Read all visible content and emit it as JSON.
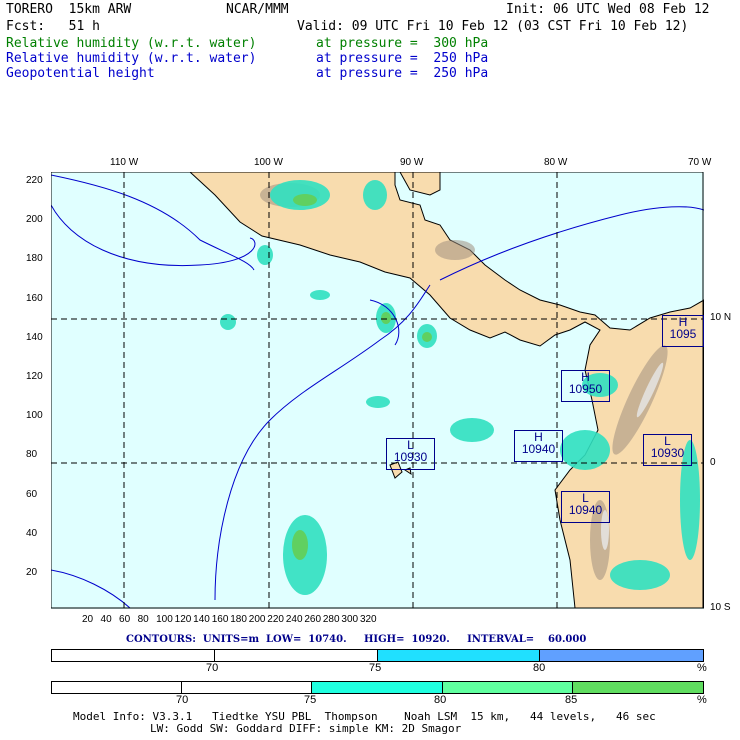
{
  "header": {
    "model": "TORERO  15km ARW",
    "org": "NCAR/MMM",
    "init": "Init: 06 UTC Wed 08 Feb 12",
    "fcst": "Fcst:   51 h",
    "valid": "Valid: 09 UTC Fri 10 Feb 12 (03 CST Fri 10 Feb 12)",
    "fields": [
      {
        "name": "Relative humidity (w.r.t. water)",
        "level": "at pressure =  300 hPa",
        "color": "#008000"
      },
      {
        "name": "Relative humidity (w.r.t. water)",
        "level": "at pressure =  250 hPa",
        "color": "#0000cc"
      },
      {
        "name": "Geopotential height",
        "level": "at pressure =  250 hPa",
        "color": "#0000cc"
      }
    ]
  },
  "map": {
    "lon_labels": [
      "110 W",
      "100 W",
      "90 W",
      "80 W",
      "70 W"
    ],
    "lat_labels": [
      "10 N",
      "0",
      "10 S"
    ],
    "y_ticks": [
      "220",
      "200",
      "180",
      "160",
      "140",
      "120",
      "100",
      "80",
      "60",
      "40",
      "20"
    ],
    "x_ticks": [
      "20",
      "40",
      "60",
      "80",
      "100",
      "120",
      "140",
      "160",
      "180",
      "200",
      "220",
      "240",
      "260",
      "280",
      "300",
      "320"
    ],
    "centers": [
      {
        "type": "L",
        "value": "10930"
      },
      {
        "type": "H",
        "value": "10940"
      },
      {
        "type": "H",
        "value": "10950"
      },
      {
        "type": "H",
        "value": "1095"
      },
      {
        "type": "L",
        "value": "10930"
      },
      {
        "type": "L",
        "value": "10940"
      }
    ]
  },
  "contours": "CONTOURS:  UNITS=m  LOW=  10740.     HIGH=  10920.     INTERVAL=    60.000",
  "legend1": {
    "labels": [
      "70",
      "75",
      "80",
      "%"
    ],
    "colors": [
      "#ffffff",
      "#ffffff",
      "#20e0ff",
      "#60a0ff"
    ]
  },
  "legend2": {
    "labels": [
      "70",
      "75",
      "80",
      "85",
      "%"
    ],
    "colors": [
      "#ffffff",
      "#ffffff",
      "#20ffe0",
      "#60ff9f",
      "#60dd60"
    ]
  },
  "footer": {
    "line1": "Model Info: V3.3.1   Tiedtke YSU PBL  Thompson    Noah LSM  15 km,   44 levels,   46 sec",
    "line2": "LW: Godd SW: Goddard DIFF: simple KM: 2D Smagor"
  }
}
